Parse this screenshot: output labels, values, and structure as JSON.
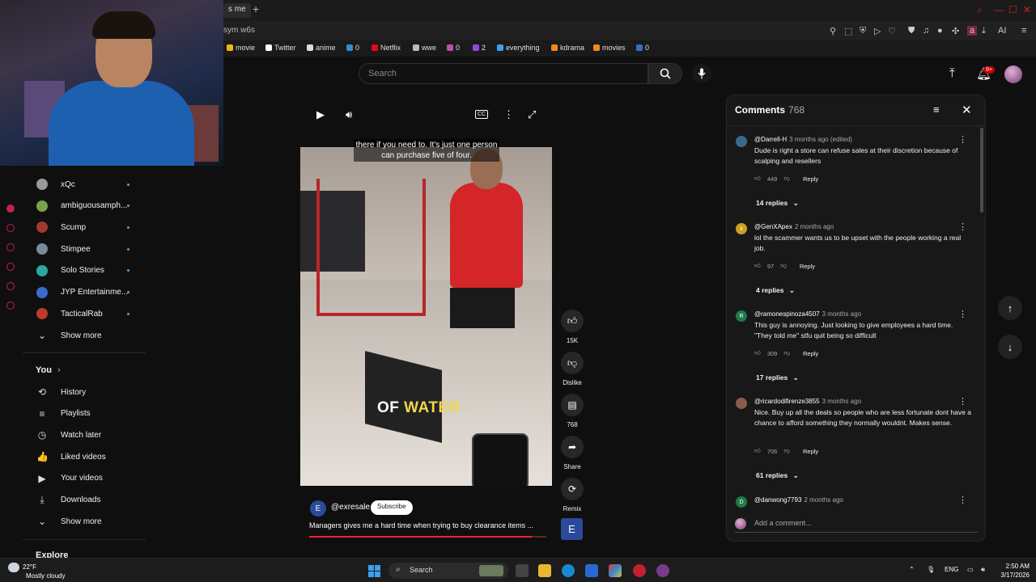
{
  "browser": {
    "tab_label": "s me",
    "url": "sym w6s",
    "bookmarks": [
      {
        "label": "movie",
        "color": "#f2b41a"
      },
      {
        "label": "Twitter",
        "color": "#ffffff"
      },
      {
        "label": "anime",
        "color": "#dddddd"
      },
      {
        "label": "0",
        "color": "#2f8fd6"
      },
      {
        "label": "Netflix",
        "color": "#e50914"
      },
      {
        "label": "wwe",
        "color": "#bbbbbb"
      },
      {
        "label": "0",
        "color": "#c04cb0"
      },
      {
        "label": "2",
        "color": "#8a4ddb"
      },
      {
        "label": "everything",
        "color": "#3aa0f0"
      },
      {
        "label": "kdrama",
        "color": "#f08a20"
      },
      {
        "label": "movies",
        "color": "#f08a20"
      },
      {
        "label": "0",
        "color": "#3f6ac9"
      }
    ]
  },
  "header": {
    "search_placeholder": "Search",
    "notif_badge": "9+"
  },
  "sidebar": {
    "subscriptions": [
      {
        "label": "xQc",
        "color": "#9a9a9a"
      },
      {
        "label": "ambiguousamph...",
        "color": "#7aa04a"
      },
      {
        "label": "Scump",
        "color": "#a03a2a"
      },
      {
        "label": "Stimpee",
        "color": "#7a8a9a"
      },
      {
        "label": "Solo Stories",
        "color": "#2aa8a0"
      },
      {
        "label": "JYP Entertainme...",
        "color": "#3a6ad0"
      },
      {
        "label": "TacticalRab",
        "color": "#c03a2a"
      }
    ],
    "show_more_1": "Show more",
    "you_heading": "You",
    "you_items": [
      {
        "label": "History",
        "icon": "history-icon",
        "glyph": "⟲"
      },
      {
        "label": "Playlists",
        "icon": "playlists-icon",
        "glyph": "≡"
      },
      {
        "label": "Watch later",
        "icon": "watch-later-icon",
        "glyph": "◷"
      },
      {
        "label": "Liked videos",
        "icon": "liked-icon",
        "glyph": "👍"
      },
      {
        "label": "Your videos",
        "icon": "your-videos-icon",
        "glyph": "▶"
      },
      {
        "label": "Downloads",
        "icon": "download-icon",
        "glyph": "⤓"
      }
    ],
    "show_more_2": "Show more",
    "explore_heading": "Explore"
  },
  "video": {
    "caption_top": "there if you need to. It's just one person can purchase five of four.",
    "caption_big_1": "OF",
    "caption_big_2": "WATER",
    "channel": "@exresale",
    "subscribe_label": "Subscribe",
    "title": "Managers gives me a hard time when trying to buy clearance items ...",
    "progress": 0.94
  },
  "actions": {
    "like_count": "15K",
    "dislike_label": "Dislike",
    "comment_count": "768",
    "share_label": "Share",
    "remix_label": "Remix"
  },
  "comments": {
    "title": "Comments",
    "count": "768",
    "add_placeholder": "Add a comment...",
    "items": [
      {
        "author": "@Darrell-H",
        "meta": "3 months ago (edited)",
        "text": "Dude is right a store can refuse sales at their discretion because of scalping and resellers",
        "likes": "449",
        "reply": "Reply",
        "replies": "14 replies",
        "avatar_color": "#3a6a8a",
        "initial": ""
      },
      {
        "author": "@GenXApex",
        "meta": "2 months ago",
        "text": "lol the scammer wants us to be upset with the people working a real job.",
        "likes": "97",
        "reply": "Reply",
        "replies": "4 replies",
        "avatar_color": "#c9a21a",
        "initial": "X"
      },
      {
        "author": "@ramonespinoza4507",
        "meta": "3 months ago",
        "text": "This guy is annoying. Just looking to give employees a hard time. \"They told me\" stfu quit being so difficult",
        "likes": "309",
        "reply": "Reply",
        "replies": "17 replies",
        "avatar_color": "#1f7a4a",
        "initial": "R"
      },
      {
        "author": "@ricardodifirenze3855",
        "meta": "3 months ago",
        "text": "Nice. Buy up all the deals so people who are less fortunate dont have a chance to afford something they normally wouldnt. Makes sense.",
        "likes": "706",
        "reply": "Reply",
        "replies": "61 replies",
        "avatar_color": "#8a5a4a",
        "initial": ""
      },
      {
        "author": "@danwong7793",
        "meta": "2 months ago",
        "text": "",
        "likes": "",
        "reply": "",
        "replies": "",
        "avatar_color": "#1f7a4a",
        "initial": "D"
      }
    ]
  },
  "taskbar": {
    "temp": "22°F",
    "weather": "Mostly cloudy",
    "search_label": "Search",
    "lang": "ENG",
    "time": "2:50 AM",
    "date": "3/17/2026"
  }
}
